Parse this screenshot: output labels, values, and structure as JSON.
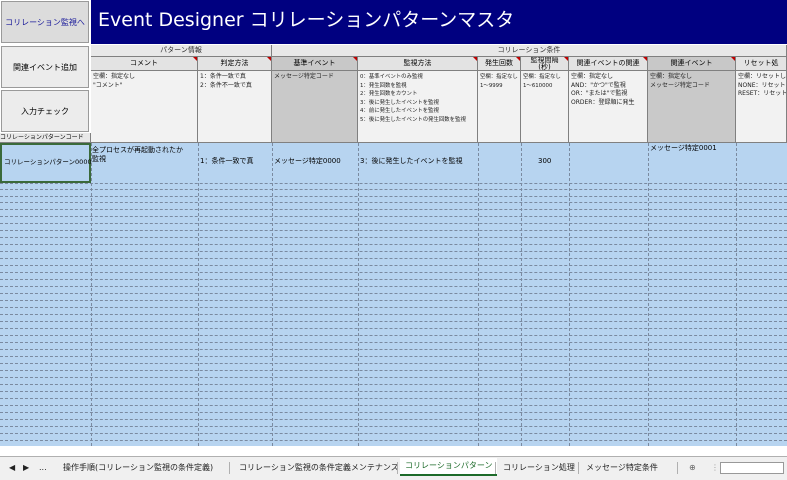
{
  "buttons": {
    "correlation_monitor": "コリレーション監視へ",
    "add_related_event": "関連イベント追加",
    "input_check": "入力チェック"
  },
  "title": "Event Designer コリレーションパターンマスタ",
  "group_headers": {
    "pattern_info": "パターン情報",
    "correlation_conditions": "コリレーション条件"
  },
  "row_header_label": "コリレーションパターンコード",
  "columns": [
    {
      "label": "コメント",
      "desc": "空欄：指定なし\n\"コメント\""
    },
    {
      "label": "判定方法",
      "desc": "1：条件一致で真\n2：条件不一致で真"
    },
    {
      "label": "基準イベント",
      "desc": "メッセージ特定コード"
    },
    {
      "label": "監視方法",
      "desc": "0：基準イベントのみ監視\n1：発生回数を監視\n2：発生回数をカウント\n3：後に発生したイベントを監視\n4：前に発生したイベントを監視\n5：後に発生したイベントの発生回数を監視"
    },
    {
      "label": "発生回数",
      "desc": "空欄：指定なし\n1～9999"
    },
    {
      "label": "監視間隔\n(秒)",
      "desc": "空欄：指定なし\n1～610000"
    },
    {
      "label": "関連イベントの関連",
      "desc": "空欄：指定なし\nAND：\"かつ\"で監視\nOR：\"または\"で監視\nORDER：登録順に発生"
    },
    {
      "label": "関連イベント",
      "desc": "空欄：指定なし\nメッセージ特定コード"
    },
    {
      "label": "リセット処",
      "desc": "空欄：リセットし\nNONE：リセットし\nRESET：リセット"
    }
  ],
  "record": {
    "code": "コリレーションパターン0000",
    "comment": "全プロセスが再起動されたか\n監視",
    "judgement": "1：条件一致で真",
    "base_event": "メッセージ特定0000",
    "monitor_method": "3：後に発生したイベントを監視",
    "interval": "300",
    "related_event": "メッセージ特定0001"
  },
  "sheet_tabs": {
    "ellipsis": "...",
    "t1": "操作手順(コリレーション監視の条件定義)",
    "t2": "コリレーション監視の条件定義メンテナンス",
    "t3": "コリレーションパターン",
    "t4": "コリレーション処理",
    "t5": "メッセージ特定条件"
  },
  "colors": {
    "title_bg": "#000080",
    "selected_row": "#b7d4f0",
    "active_tab": "#1d6b2a"
  }
}
